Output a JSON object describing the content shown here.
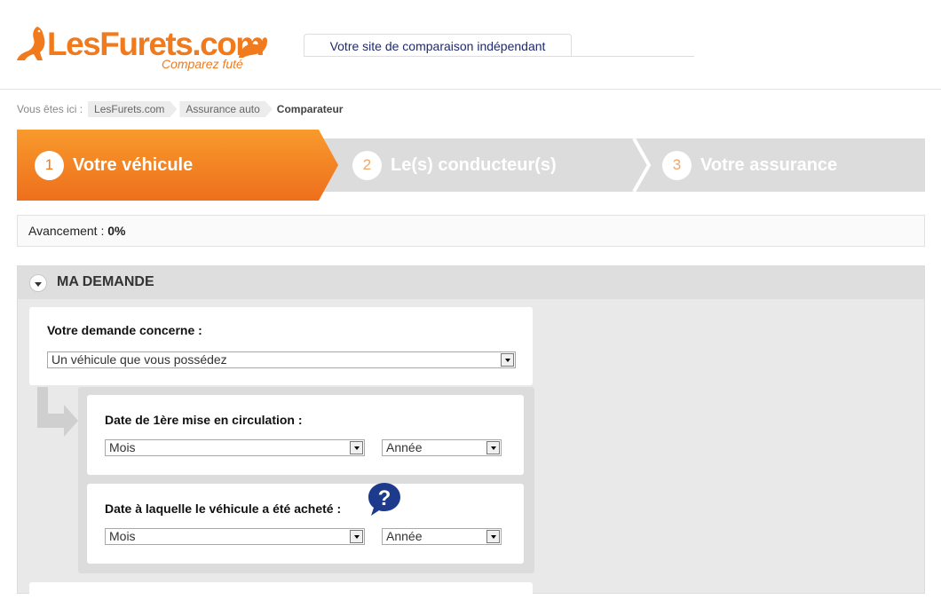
{
  "header": {
    "logo_text": "LesFurets.com",
    "logo_sub": "Comparez futé",
    "tagline": "Votre site de comparaison indépendant"
  },
  "breadcrumb": {
    "prefix": "Vous êtes ici :",
    "items": [
      "LesFurets.com",
      "Assurance auto"
    ],
    "current": "Comparateur"
  },
  "steps": [
    {
      "num": "1",
      "label": "Votre véhicule",
      "active": true
    },
    {
      "num": "2",
      "label": "Le(s) conducteur(s)",
      "active": false
    },
    {
      "num": "3",
      "label": "Votre assurance",
      "active": false
    }
  ],
  "progress": {
    "label": "Avancement :",
    "value": "0%"
  },
  "section": {
    "title": "MA DEMANDE",
    "demand": {
      "label": "Votre demande concerne :",
      "value": "Un véhicule que vous possédez"
    },
    "first_registration": {
      "label": "Date de 1ère mise en circulation :",
      "month": "Mois",
      "year": "Année"
    },
    "purchase_date": {
      "label": "Date à laquelle le véhicule a été acheté :",
      "month": "Mois",
      "year": "Année"
    }
  },
  "colors": {
    "brand_orange": "#f07a1c",
    "navy": "#1e2a6e",
    "inactive_step": "#dcdcdc"
  }
}
